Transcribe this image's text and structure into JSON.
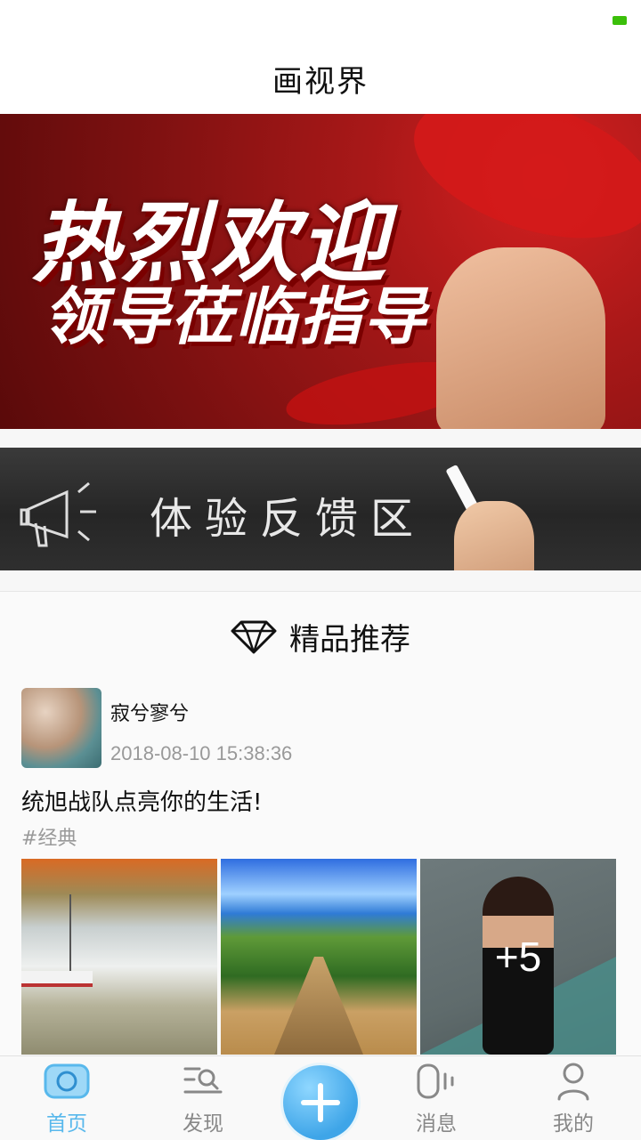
{
  "app": {
    "title": "画视界"
  },
  "banners": [
    {
      "line1": "热烈欢迎",
      "line2": "领导莅临指导"
    },
    {
      "text": "体验反馈区"
    }
  ],
  "section": {
    "title": "精品推荐",
    "icon": "diamond-icon"
  },
  "post": {
    "username": "寂兮寥兮",
    "time": "2018-08-10 15:38:36",
    "content": "统旭战队点亮你的生活!",
    "tag": "#经典",
    "more_count": "+5"
  },
  "tabbar": {
    "items": [
      {
        "label": "首页",
        "icon": "home-icon",
        "active": true
      },
      {
        "label": "发现",
        "icon": "discover-icon",
        "active": false
      },
      {
        "label": "",
        "icon": "plus-icon",
        "active": false
      },
      {
        "label": "消息",
        "icon": "message-icon",
        "active": false
      },
      {
        "label": "我的",
        "icon": "profile-icon",
        "active": false
      }
    ]
  },
  "colors": {
    "accent": "#58b8ec",
    "banner_red": "#a81818"
  }
}
